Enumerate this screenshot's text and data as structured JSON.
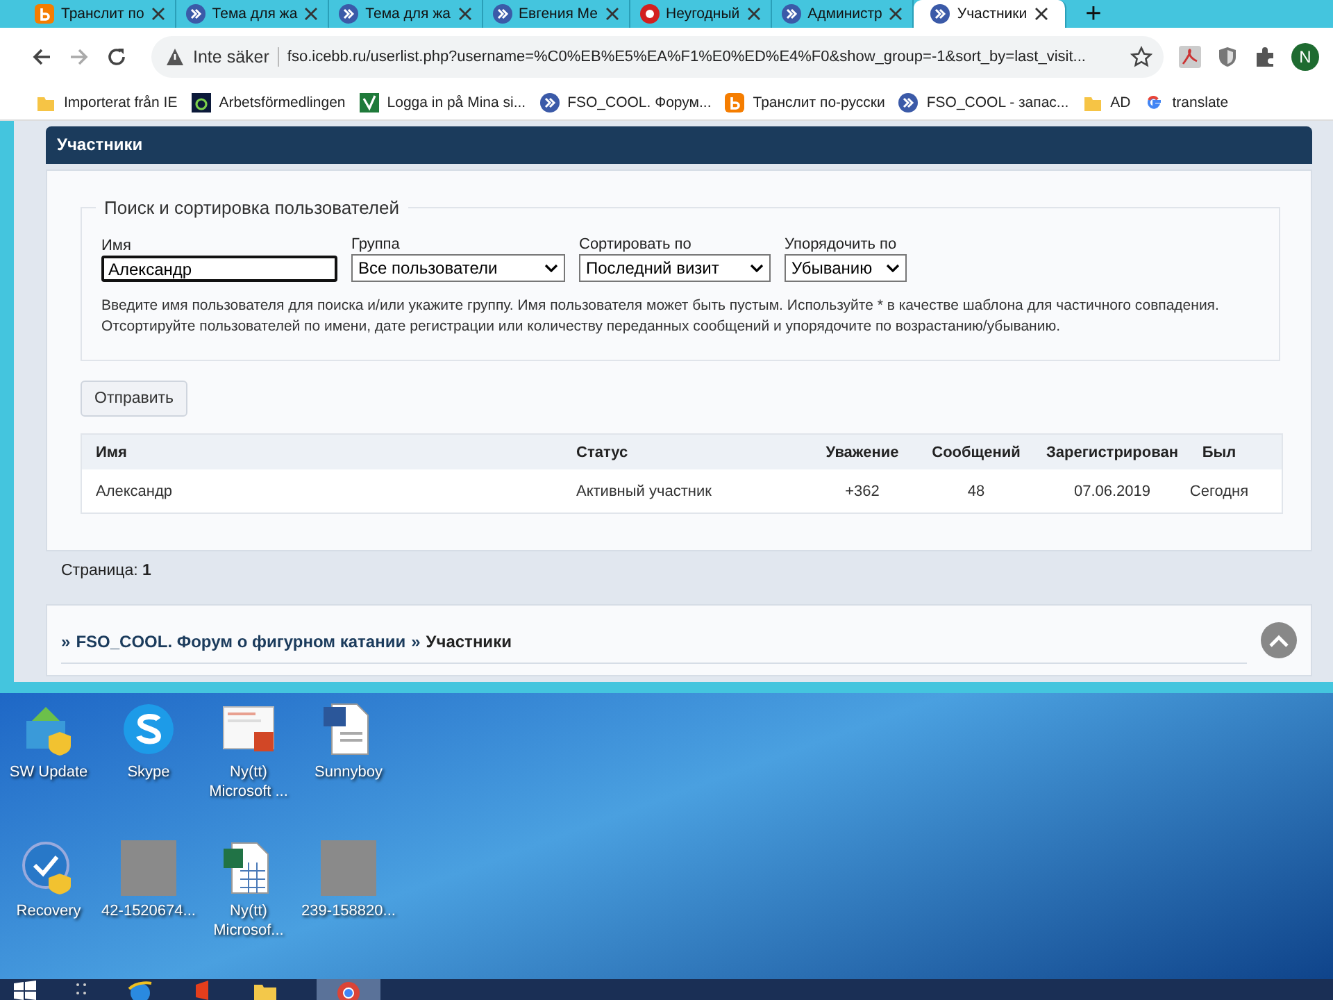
{
  "browser": {
    "tabs": [
      {
        "label": "Транслит по",
        "kind": "letter",
        "selected": false
      },
      {
        "label": "Тема для жа",
        "kind": "swirl",
        "selected": false
      },
      {
        "label": "Тема для жа",
        "kind": "swirl",
        "selected": false
      },
      {
        "label": "Евгения Ме",
        "kind": "swirl",
        "selected": false
      },
      {
        "label": "Неугодный",
        "kind": "badge",
        "selected": false
      },
      {
        "label": "Администр",
        "kind": "swirl",
        "selected": false
      },
      {
        "label": "Участники",
        "kind": "swirl",
        "selected": true
      }
    ],
    "new_tab": "+",
    "security": "Inte säker",
    "url": "fso.icebb.ru/userlist.php?username=%C0%EB%E5%EA%F1%E0%ED%E4%F0&show_group=-1&sort_by=last_visit...",
    "profile": "N",
    "bookmarks": [
      {
        "label": "Importerat från IE",
        "kind": "folder"
      },
      {
        "label": "Arbetsförmedlingen",
        "kind": "ring"
      },
      {
        "label": "Logga in på Mina si...",
        "kind": "check"
      },
      {
        "label": "FSO_COOL. Форум...",
        "kind": "swirl"
      },
      {
        "label": "Транслит по-русски",
        "kind": "letter"
      },
      {
        "label": "FSO_COOL - запас...",
        "kind": "swirl"
      },
      {
        "label": "AD",
        "kind": "folder"
      },
      {
        "label": "translate",
        "kind": "google"
      }
    ]
  },
  "page": {
    "title": "Участники",
    "search": {
      "legend": "Поиск и сортировка пользователей",
      "fields": [
        {
          "label": "Имя",
          "kind": "input",
          "value": "Александр"
        },
        {
          "label": "Группа",
          "kind": "select",
          "value": "Все пользователи"
        },
        {
          "label": "Сортировать по",
          "kind": "select",
          "value": "Последний визит"
        },
        {
          "label": "Упорядочить по",
          "kind": "select",
          "value": "Убыванию"
        }
      ],
      "help": "Введите имя пользователя для поиска и/или укажите группу. Имя пользователя может быть пустым. Используйте * в качестве шаблона для частичного совпадения. Отсортируйте пользователей по имени, дате регистрации или количеству переданных сообщений и упорядочите по возрастанию/убыванию."
    },
    "submit": "Отправить",
    "table": {
      "columns": [
        "Имя",
        "Статус",
        "Уважение",
        "Сообщений",
        "Зарегистрирован",
        "Был"
      ],
      "rows": [
        [
          "Александр",
          "Активный участник",
          "+362",
          "48",
          "07.06.2019",
          "Сегодня"
        ]
      ]
    },
    "pages": "Страница: **1**",
    "breadcrumb": [
      {
        "sep": "»",
        "label": "FSO_COOL. Форум о фигурном катании",
        "link": true
      },
      {
        "sep": "»",
        "label": "Участники",
        "link": false
      }
    ]
  },
  "desktop": {
    "icons": [
      {
        "label": "SW Update",
        "kind": "update"
      },
      {
        "label": "Skype",
        "kind": "skype"
      },
      {
        "label": "Ny(tt) Microsoft ...",
        "kind": "slides"
      },
      {
        "label": "Sunnyboy",
        "kind": "doc"
      },
      {
        "label": "Recovery",
        "kind": "recovery"
      },
      {
        "label": "42-1520674...",
        "kind": "photo"
      },
      {
        "label": "Ny(tt) Microsof...",
        "kind": "sheet"
      },
      {
        "label": "239-158820...",
        "kind": "photo"
      }
    ]
  }
}
